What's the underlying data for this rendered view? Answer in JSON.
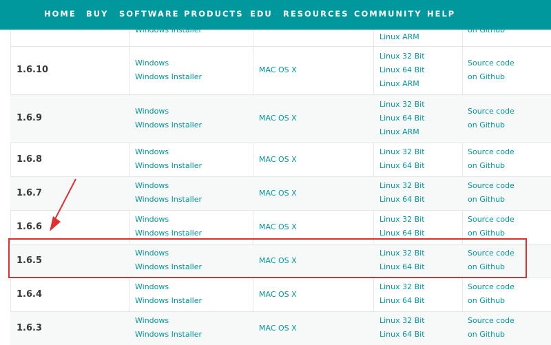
{
  "nav": {
    "items": [
      {
        "label": "HOME"
      },
      {
        "label": "BUY"
      },
      {
        "label": "SOFTWARE"
      },
      {
        "label": "PRODUCTS"
      },
      {
        "label": "EDU"
      },
      {
        "label": "RESOURCES"
      },
      {
        "label": "COMMUNITY"
      },
      {
        "label": "HELP"
      }
    ]
  },
  "top_partial": {
    "windows": "Windows Installer",
    "linux": "Linux ARM",
    "source": "on Github"
  },
  "rows": [
    {
      "version": "1.6.10",
      "windows": [
        "Windows",
        "Windows Installer"
      ],
      "mac": "MAC OS X",
      "linux": [
        "Linux 32 Bit",
        "Linux 64 Bit",
        "Linux ARM"
      ],
      "source": [
        "Source code",
        "on Github"
      ]
    },
    {
      "version": "1.6.9",
      "windows": [
        "Windows",
        "Windows Installer"
      ],
      "mac": "MAC OS X",
      "linux": [
        "Linux 32 Bit",
        "Linux 64 Bit",
        "Linux ARM"
      ],
      "source": [
        "Source code",
        "on Github"
      ]
    },
    {
      "version": "1.6.8",
      "windows": [
        "Windows",
        "Windows Installer"
      ],
      "mac": "MAC OS X",
      "linux": [
        "Linux 32 Bit",
        "Linux 64 Bit"
      ],
      "source": [
        "Source code",
        "on Github"
      ]
    },
    {
      "version": "1.6.7",
      "windows": [
        "Windows",
        "Windows Installer"
      ],
      "mac": "MAC OS X",
      "linux": [
        "Linux 32 Bit",
        "Linux 64 Bit"
      ],
      "source": [
        "Source code",
        "on Github"
      ]
    },
    {
      "version": "1.6.6",
      "windows": [
        "Windows",
        "Windows Installer"
      ],
      "mac": "MAC OS X",
      "linux": [
        "Linux 32 Bit",
        "Linux 64 Bit"
      ],
      "source": [
        "Source code",
        "on Github"
      ]
    },
    {
      "version": "1.6.5",
      "windows": [
        "Windows",
        "Windows Installer"
      ],
      "mac": "MAC OS X",
      "linux": [
        "Linux 32 Bit",
        "Linux 64 Bit"
      ],
      "source": [
        "Source code",
        "on Github"
      ]
    },
    {
      "version": "1.6.4",
      "windows": [
        "Windows",
        "Windows Installer"
      ],
      "mac": "MAC OS X",
      "linux": [
        "Linux 32 Bit",
        "Linux 64 Bit"
      ],
      "source": [
        "Source code",
        "on Github"
      ]
    },
    {
      "version": "1.6.3",
      "windows": [
        "Windows",
        "Windows Installer"
      ],
      "mac": "MAC OS X",
      "linux": [
        "Linux 32 Bit",
        "Linux 64 Bit"
      ],
      "source": [
        "Source code",
        "on Github"
      ]
    }
  ],
  "colors": {
    "nav_bg": "#00979d",
    "link": "#00979d",
    "highlight": "#e02f2f",
    "row_alt": "#f7f9f9"
  }
}
